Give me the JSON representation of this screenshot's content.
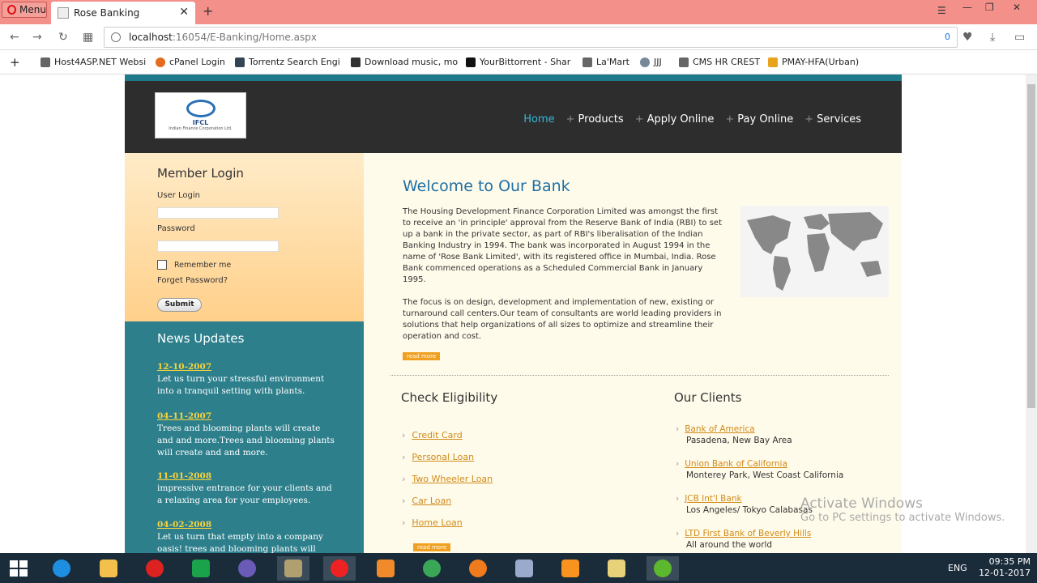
{
  "browser": {
    "menu_label": "Menu",
    "tab_title": "Rose Banking",
    "url_host": "localhost",
    "url_path": ":16054/E-Banking/Home.aspx",
    "blocked_count": "0",
    "bookmarks": [
      {
        "label": "Host4ASP.NET Websi"
      },
      {
        "label": "cPanel Login"
      },
      {
        "label": "Torrentz Search Engi"
      },
      {
        "label": "Download music, mo"
      },
      {
        "label": "YourBittorrent - Shar"
      },
      {
        "label": "La'Mart"
      },
      {
        "label": "JJJ"
      },
      {
        "label": "CMS HR CREST"
      },
      {
        "label": "PMAY-HFA(Urban)"
      }
    ]
  },
  "site": {
    "logo_text": "IFCL",
    "logo_sub": "Indian Finance Corporation Ltd.",
    "nav": [
      "Home",
      "Products",
      "Apply Online",
      "Pay Online",
      "Services"
    ],
    "login": {
      "title": "Member Login",
      "user_label": "User Login",
      "password_label": "Password",
      "remember_label": "Remember me",
      "forgot_label": "Forget Password?",
      "submit_label": "Submit"
    },
    "news": {
      "title": "News Updates",
      "items": [
        {
          "date": "12-10-2007",
          "text": "Let us turn your stressful environment into a tranquil setting with plants."
        },
        {
          "date": "04-11-2007",
          "text": "Trees and blooming plants will create and and more.Trees and blooming plants will create and and more."
        },
        {
          "date": "11-01-2008",
          "text": "impressive entrance for your clients and a relaxing area for your employees."
        },
        {
          "date": "04-02-2008",
          "text": "Let us turn that empty into a company oasis! trees and blooming plants will create."
        }
      ]
    },
    "welcome": {
      "title": "Welcome to Our Bank",
      "para1": "The Housing Development Finance Corporation Limited was amongst the first to receive an 'in principle' approval from the Reserve Bank of India (RBI) to set up a bank in the private sector, as part of RBI's liberalisation of the Indian Banking Industry in 1994. The bank was incorporated in August 1994 in the name of 'Rose Bank Limited', with its registered office in Mumbai, India. Rose Bank commenced operations as a Scheduled Commercial Bank in January 1995.",
      "para2": "The focus is on design, development and implementation of new, existing or turnaround call centers.Our team of consultants are world leading providers in solutions that help organizations of all sizes to optimize and streamline their operation and cost.",
      "read_more": "read more"
    },
    "eligibility": {
      "title": "Check Eligibility",
      "items": [
        "Credit Card",
        "Personal Loan",
        "Two Wheeler Loan",
        "Car Loan",
        "Home Loan"
      ],
      "read_more": "read more"
    },
    "clients": {
      "title": "Our Clients",
      "items": [
        {
          "name": "Bank of America",
          "location": "Pasadena, New Bay Area"
        },
        {
          "name": "Union Bank of California",
          "location": "Monterey Park, West Coast California"
        },
        {
          "name": "JCB Int'l Bank",
          "location": "Los Angeles/ Tokyo Calabasas"
        },
        {
          "name": "LTD First Bank of Beverly Hills",
          "location": "All around the world"
        }
      ]
    }
  },
  "os": {
    "activate_title": "Activate Windows",
    "activate_sub": "Go to PC settings to activate Windows.",
    "lang": "ENG",
    "time": "09:35 PM",
    "date": "12-01-2017"
  }
}
